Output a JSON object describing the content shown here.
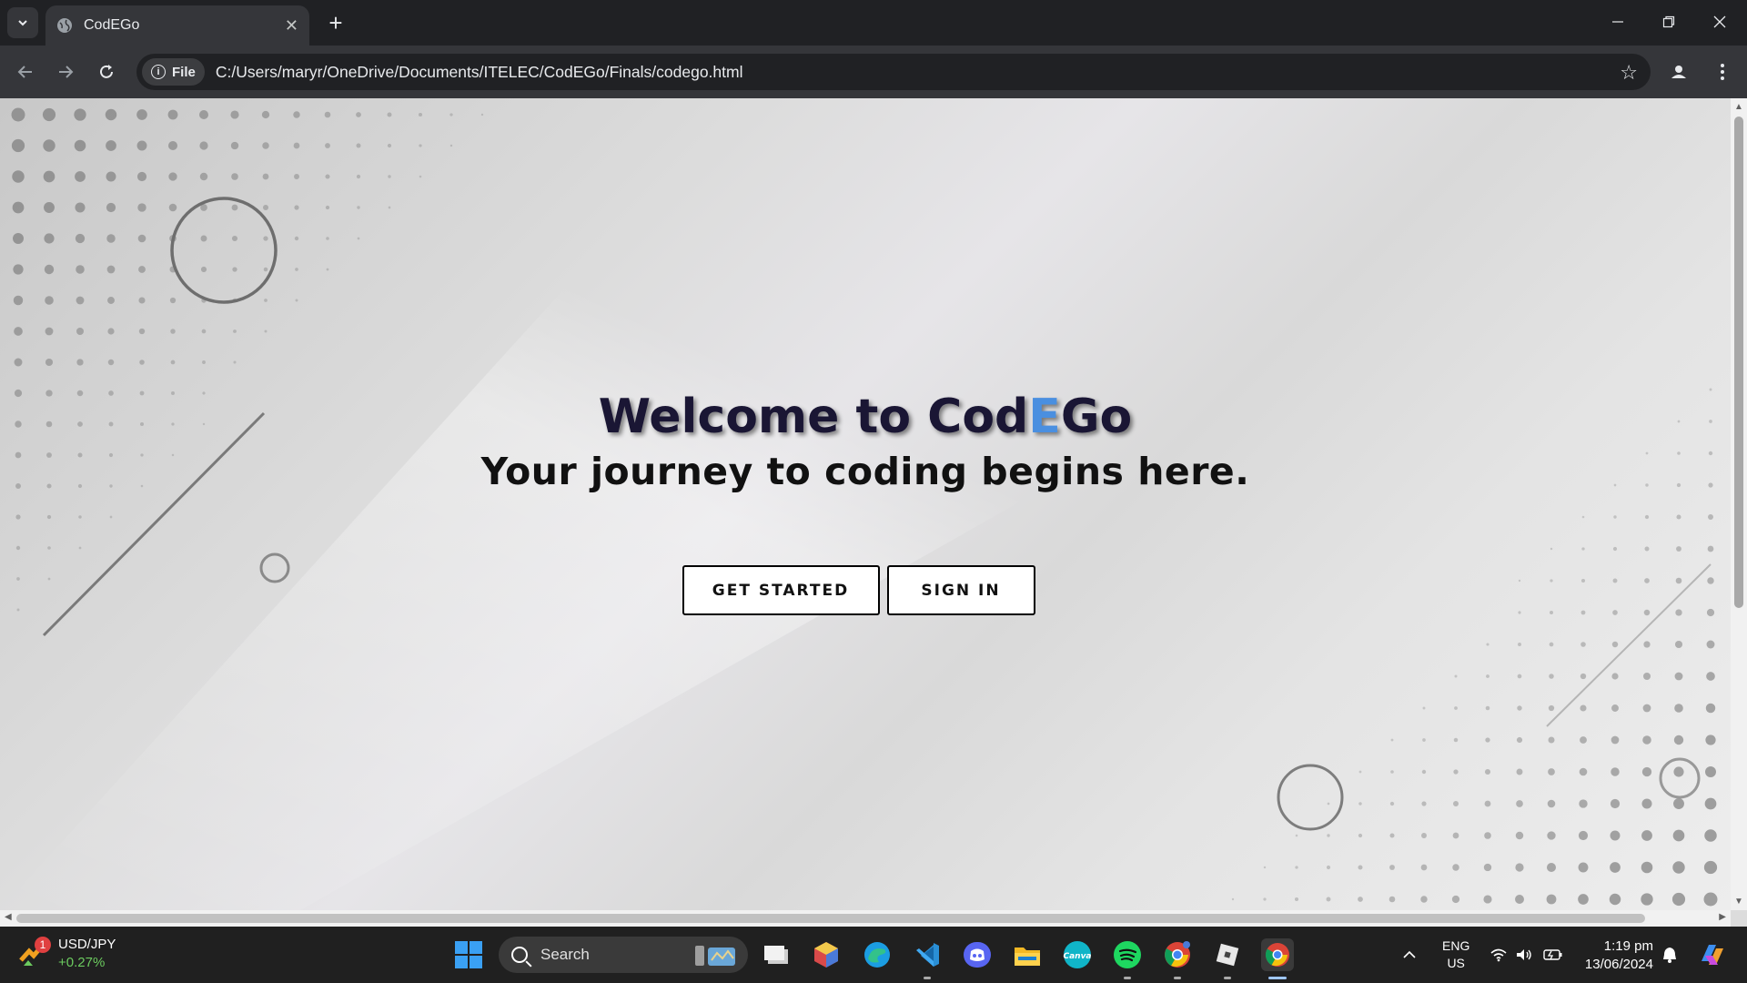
{
  "browser": {
    "tab_title": "CodEGo",
    "url_chip": "File",
    "url": "C:/Users/maryr/OneDrive/Documents/ITELEC/CodEGo/Finals/codego.html"
  },
  "page": {
    "welcome_prefix": "Welcome to Cod",
    "welcome_accent": "E",
    "welcome_suffix": "Go",
    "subtitle": "Your journey to coding begins here.",
    "get_started": "GET STARTED",
    "sign_in": "SIGN IN",
    "accent_color": "#4a8fe0",
    "title_color": "#1a1634"
  },
  "taskbar": {
    "ticker_symbol": "USD/JPY",
    "ticker_change": "+0.27%",
    "ticker_badge": "1",
    "search_placeholder": "Search",
    "lang_line1": "ENG",
    "lang_line2": "US",
    "time": "1:19 pm",
    "date": "13/06/2024"
  }
}
